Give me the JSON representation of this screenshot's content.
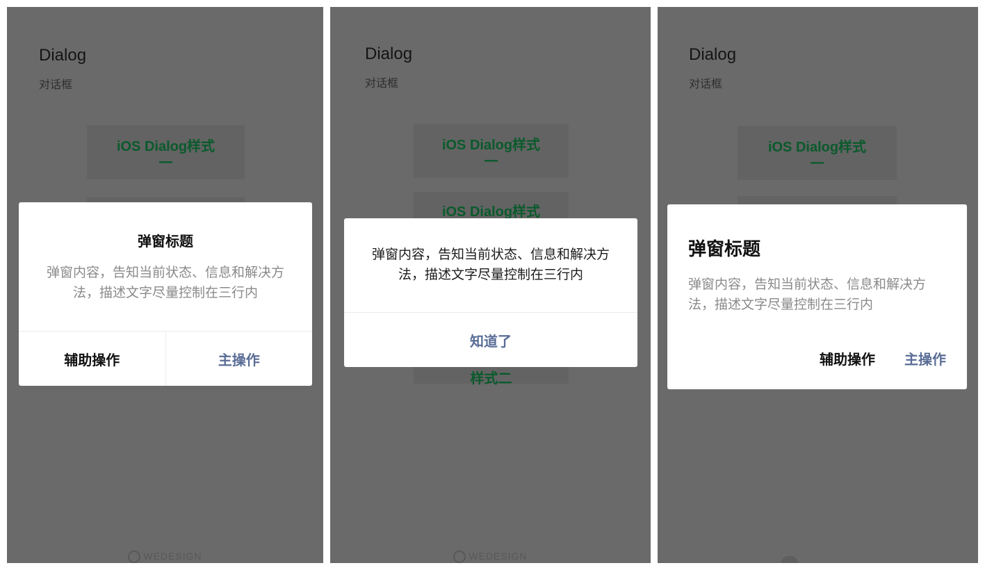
{
  "panels": [
    {
      "header": {
        "title": "Dialog",
        "subtitle": "对话框"
      },
      "cards": [
        {
          "label": "iOS Dialog样式",
          "dash": "一"
        }
      ],
      "watermark": "WEDESIGN",
      "dialog": {
        "title": "弹窗标题",
        "body": "弹窗内容，告知当前状态、信息和解决方法，描述文字尽量控制在三行内",
        "secondary_label": "辅助操作",
        "primary_label": "主操作"
      }
    },
    {
      "header": {
        "title": "Dialog",
        "subtitle": "对话框"
      },
      "cards": [
        {
          "label": "iOS Dialog样式",
          "dash": "一"
        },
        {
          "label": "iOS Dialog样式",
          "dash": ""
        },
        {
          "label": "样式二",
          "dash": ""
        }
      ],
      "watermark": "WEDESIGN",
      "dialog": {
        "body": "弹窗内容，告知当前状态、信息和解决方法，描述文字尽量控制在三行内",
        "primary_label": "知道了"
      }
    },
    {
      "header": {
        "title": "Dialog",
        "subtitle": "对话框"
      },
      "cards": [
        {
          "label": "iOS Dialog样式",
          "dash": "一"
        }
      ],
      "dialog": {
        "title": "弹窗标题",
        "body": "弹窗内容，告知当前状态、信息和解决方法，描述文字尽量控制在三行内",
        "secondary_label": "辅助操作",
        "primary_label": "主操作"
      }
    }
  ],
  "colors": {
    "overlay_background": "#6a6a6a",
    "dialog_background": "#ffffff",
    "primary_action": "#5a6d96",
    "card_text": "#0a5a2c"
  }
}
